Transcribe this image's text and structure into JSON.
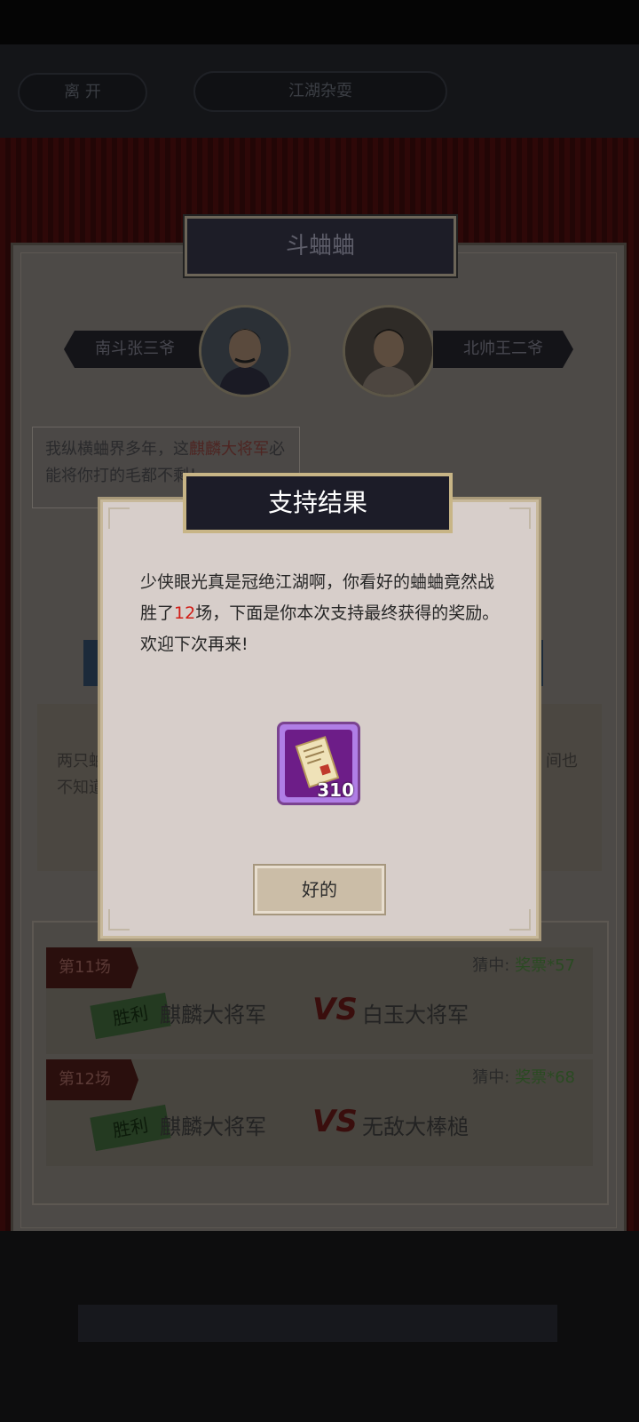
{
  "header": {
    "leave_label": "离 开",
    "title": "江湖杂耍"
  },
  "game": {
    "panel_title": "斗蛐蛐",
    "left_player": "南斗张三爷",
    "right_player": "北帅王二爷",
    "speech_part1": "我纵横蛐界多年，这",
    "speech_highlight": "麒麟大将军",
    "speech_part2": "必能将你打的毛都不剩！",
    "dim_text_left": "两只蛐\n不知道",
    "dim_text_right": "间也"
  },
  "matches": [
    {
      "round": "第11场",
      "guess_label": "猜中:",
      "reward": "奖票*57",
      "result_stamp": "胜利",
      "team_a": "麒麟大将军",
      "vs": "VS",
      "team_b": "白玉大将军"
    },
    {
      "round": "第12场",
      "guess_label": "猜中:",
      "reward": "奖票*68",
      "result_stamp": "胜利",
      "team_a": "麒麟大将军",
      "vs": "VS",
      "team_b": "无敌大棒槌"
    }
  ],
  "modal": {
    "title": "支持结果",
    "msg_part1": "少侠眼光真是冠绝江湖啊，你看好的蛐蛐竟然战胜了",
    "msg_highlight": "12",
    "msg_part2": "场，下面是你本次支持最终获得的奖励。欢迎下次再来!",
    "item_icon": "ticket-scroll-icon",
    "item_count": "310",
    "ok_label": "好的"
  },
  "colors": {
    "highlight_red": "#d11d17",
    "reward_green": "#2a4a22",
    "modal_bg": "#d7ceca",
    "banner_dark": "#1c1c28",
    "item_purple": "#6d1d88"
  }
}
